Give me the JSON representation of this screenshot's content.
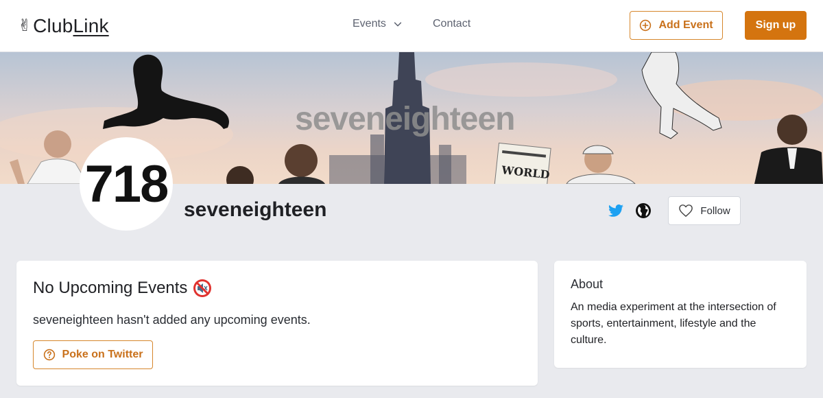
{
  "header": {
    "logo_icon": "✌",
    "logo_text_a": "Club",
    "logo_text_b": "Link",
    "nav": {
      "events_label": "Events",
      "contact_label": "Contact"
    },
    "add_event_label": "Add Event",
    "signup_label": "Sign up"
  },
  "banner": {
    "title": "seveneighteen"
  },
  "profile": {
    "avatar_text": "718",
    "name": "seveneighteen",
    "follow_label": "Follow"
  },
  "events": {
    "title": "No Upcoming Events",
    "description": "seveneighteen hasn't added any upcoming events.",
    "poke_label": "Poke on Twitter"
  },
  "about": {
    "title": "About",
    "text": "An media experiment at the intersection of sports, entertainment, lifestyle and the culture."
  },
  "colors": {
    "accent": "#d4740f",
    "twitter": "#1da1f2",
    "background": "#e9eaee"
  },
  "icons": [
    "peace-hand-icon",
    "chevron-down-icon",
    "plus-circle-icon",
    "twitter-icon",
    "globe-icon",
    "heart-icon",
    "muted-speaker-icon",
    "question-circle-icon"
  ]
}
